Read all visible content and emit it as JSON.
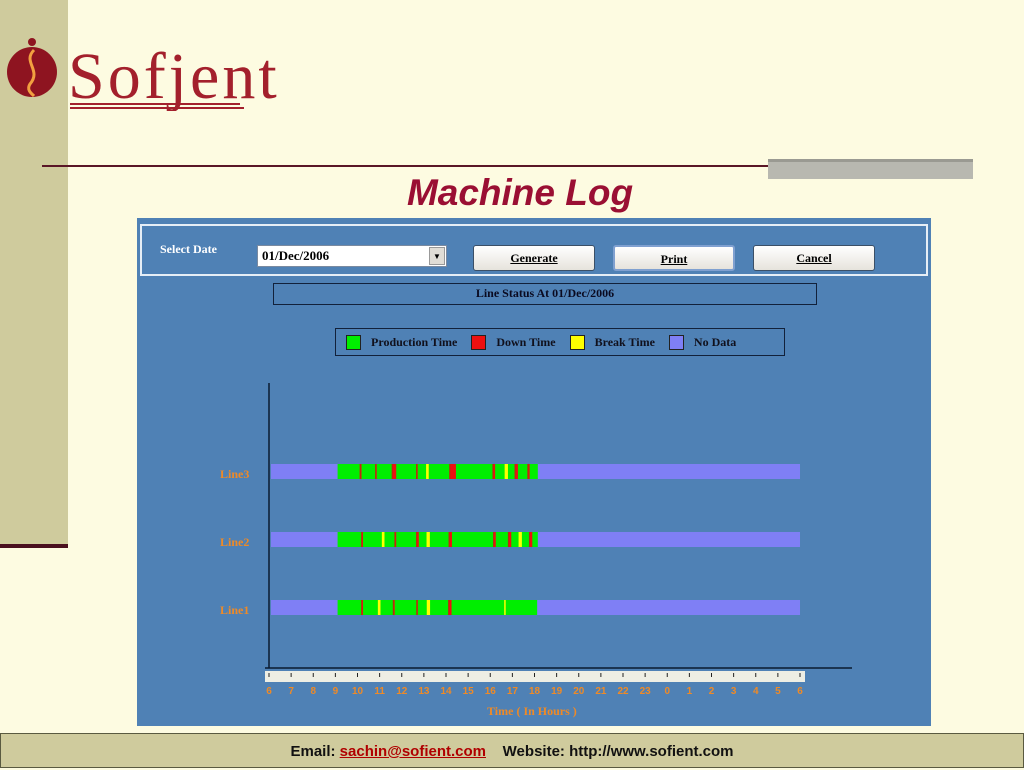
{
  "brand": {
    "logo_text": "Sofjent"
  },
  "page_title": "Machine Log",
  "app": {
    "select_date_label": "Select Date",
    "date_value": "01/Dec/2006",
    "buttons": {
      "generate": "Generate",
      "print": "Print",
      "cancel": "Cancel"
    },
    "status_title": "Line Status At 01/Dec/2006"
  },
  "colors": {
    "production": "#00ee00",
    "down": "#ee1010",
    "break": "#ffff00",
    "nodata": "#7f7ff5",
    "downDark": "#b03010"
  },
  "chart_data": {
    "type": "timeline",
    "legend": [
      {
        "key": "production",
        "label": "Production Time"
      },
      {
        "key": "down",
        "label": "Down Time"
      },
      {
        "key": "break",
        "label": "Break Time"
      },
      {
        "key": "nodata",
        "label": "No Data"
      }
    ],
    "xlabel": "Time ( In Hours )",
    "x_ticks": [
      "6",
      "7",
      "8",
      "9",
      "10",
      "11",
      "12",
      "13",
      "14",
      "15",
      "16",
      "17",
      "18",
      "19",
      "20",
      "21",
      "22",
      "23",
      "0",
      "1",
      "2",
      "3",
      "4",
      "5",
      "6"
    ],
    "x_range_hours_from_6": [
      0,
      24
    ],
    "lines": [
      {
        "name": "Line3",
        "production": [
          9.1,
          18.15
        ],
        "events": [
          {
            "at": 10.1,
            "dur": 0.08,
            "type": "down"
          },
          {
            "at": 10.8,
            "dur": 0.07,
            "type": "down"
          },
          {
            "at": 11.55,
            "dur": 0.2,
            "type": "down"
          },
          {
            "at": 12.65,
            "dur": 0.07,
            "type": "down"
          },
          {
            "at": 13.1,
            "dur": 0.12,
            "type": "break"
          },
          {
            "at": 14.15,
            "dur": 0.3,
            "type": "down"
          },
          {
            "at": 16.1,
            "dur": 0.12,
            "type": "down"
          },
          {
            "at": 16.65,
            "dur": 0.15,
            "type": "break"
          },
          {
            "at": 17.1,
            "dur": 0.15,
            "type": "down"
          },
          {
            "at": 17.68,
            "dur": 0.1,
            "type": "down"
          }
        ]
      },
      {
        "name": "Line2",
        "production": [
          9.1,
          18.15
        ],
        "events": [
          {
            "at": 10.17,
            "dur": 0.08,
            "type": "down"
          },
          {
            "at": 11.1,
            "dur": 0.12,
            "type": "break"
          },
          {
            "at": 11.67,
            "dur": 0.08,
            "type": "down"
          },
          {
            "at": 12.65,
            "dur": 0.12,
            "type": "down"
          },
          {
            "at": 13.12,
            "dur": 0.15,
            "type": "break"
          },
          {
            "at": 14.12,
            "dur": 0.15,
            "type": "down"
          },
          {
            "at": 16.13,
            "dur": 0.12,
            "type": "down"
          },
          {
            "at": 16.8,
            "dur": 0.15,
            "type": "down"
          },
          {
            "at": 17.28,
            "dur": 0.15,
            "type": "break"
          },
          {
            "at": 17.75,
            "dur": 0.15,
            "type": "down"
          }
        ]
      },
      {
        "name": "Line1",
        "production": [
          9.1,
          18.12
        ],
        "events": [
          {
            "at": 10.17,
            "dur": 0.08,
            "type": "down"
          },
          {
            "at": 10.92,
            "dur": 0.12,
            "type": "break"
          },
          {
            "at": 11.6,
            "dur": 0.08,
            "type": "down"
          },
          {
            "at": 12.66,
            "dur": 0.04,
            "type": "down"
          },
          {
            "at": 13.13,
            "dur": 0.15,
            "type": "break"
          },
          {
            "at": 14.1,
            "dur": 0.15,
            "type": "down"
          },
          {
            "at": 16.63,
            "dur": 0.04,
            "type": "break"
          }
        ]
      }
    ]
  },
  "footer": {
    "email_label": "Email:",
    "email": "sachin@sofient.com",
    "website_label": "Website:",
    "website": "http://www.sofient.com"
  }
}
